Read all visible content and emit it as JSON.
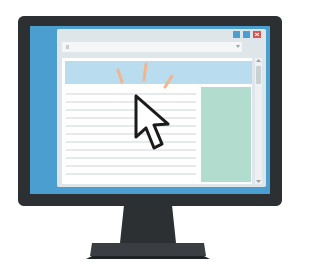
{
  "colors": {
    "monitor_bezel": "#2d3033",
    "screen": "#4a9fd0",
    "window_frame": "#dfe6ea",
    "address_bar": "#f4f6f7",
    "header_band": "#b9dcef",
    "content_bg": "#ffffff",
    "text_line": "#cfd6da",
    "sidebar": "#b2dccd",
    "scrollbar": "#c9d0d4",
    "cursor_fill": "#ffffff",
    "cursor_outline": "#1b1b1b",
    "click_rays": "#f2b58e",
    "close_button": "#d9534f",
    "window_button": "#4a9fd0",
    "stand": "#2d3033"
  },
  "icons": {
    "cursor": "arrow-cursor-icon",
    "click": "click-rays-icon",
    "minimize": "minimize-icon",
    "maximize": "maximize-icon",
    "close": "close-icon",
    "dropdown": "chevron-down-icon"
  }
}
